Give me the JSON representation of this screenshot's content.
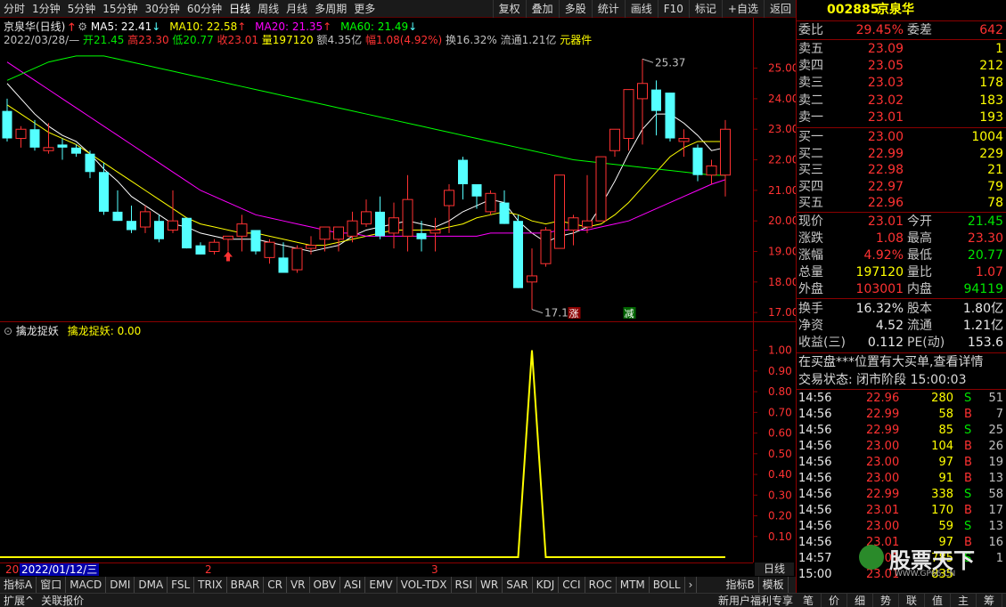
{
  "topbar": {
    "periods": [
      "分时",
      "1分钟",
      "5分钟",
      "15分钟",
      "30分钟",
      "60分钟",
      "日线",
      "周线",
      "月线",
      "多周期",
      "更多"
    ],
    "active_period": "日线",
    "buttons": [
      "复权",
      "叠加",
      "多股",
      "统计",
      "画线",
      "F10",
      "标记",
      "+自选",
      "返回"
    ]
  },
  "main": {
    "title": "京泉华(日线)",
    "ma5_label": "MA5: 22.41",
    "ma10_label": "MA10: 22.58",
    "ma20_label": "MA20: 21.35",
    "ma60_label": "MA60: 21.49",
    "info_date": "2022/03/28/—",
    "info_open": "开21.45",
    "info_high": "高23.30",
    "info_low": "低20.77",
    "info_close": "收23.01",
    "info_vol": "量197120",
    "info_amount": "额4.35亿",
    "info_change": "幅1.08(4.92%)",
    "info_turnover": "换16.32%",
    "info_float": "流通1.21亿",
    "info_sector": "元器件",
    "high_mark": "25.37",
    "low_mark": "17.11",
    "badge_up": "涨",
    "badge_down": "减",
    "colors": {
      "up": "#ff3232",
      "down": "#54ffff",
      "ma5": "#ffffff",
      "ma10": "#ffff00",
      "ma20": "#ff00ff",
      "ma60": "#00ff00"
    }
  },
  "sub": {
    "title": "擒龙捉妖",
    "value_label": "擒龙捉妖: 0.00"
  },
  "chart_data": [
    {
      "type": "candlestick",
      "title": "京泉华(日线)",
      "ylim": [
        16.8,
        25.6
      ],
      "yticks": [
        "25.00",
        "24.00",
        "23.00",
        "22.00",
        "21.00",
        "20.00",
        "19.00",
        "18.00",
        "17.00"
      ],
      "candles": [
        [
          23.6,
          24.0,
          22.6,
          22.7
        ],
        [
          22.7,
          23.1,
          22.4,
          23.0
        ],
        [
          23.0,
          23.3,
          22.3,
          22.4
        ],
        [
          22.3,
          23.2,
          22.2,
          22.4
        ],
        [
          22.5,
          22.7,
          22.0,
          22.4
        ],
        [
          22.4,
          22.5,
          22.1,
          22.2
        ],
        [
          22.2,
          22.3,
          21.4,
          21.6
        ],
        [
          21.6,
          21.9,
          20.2,
          20.3
        ],
        [
          20.3,
          21.0,
          20.0,
          20.0
        ],
        [
          20.0,
          20.5,
          19.6,
          19.7
        ],
        [
          19.8,
          20.5,
          19.6,
          20.3
        ],
        [
          20.0,
          20.2,
          19.3,
          19.4
        ],
        [
          19.7,
          21.0,
          19.6,
          20.0
        ],
        [
          20.1,
          20.1,
          19.1,
          19.1
        ],
        [
          19.2,
          19.3,
          18.9,
          18.9
        ],
        [
          19.0,
          19.4,
          18.9,
          19.3
        ],
        [
          19.4,
          19.5,
          19.0,
          19.5
        ],
        [
          19.5,
          20.2,
          19.0,
          19.9
        ],
        [
          19.7,
          19.7,
          18.9,
          19.0
        ],
        [
          18.8,
          19.4,
          18.6,
          19.3
        ],
        [
          18.8,
          19.3,
          18.3,
          18.3
        ],
        [
          18.4,
          19.2,
          18.3,
          19.1
        ],
        [
          19.1,
          19.5,
          18.9,
          19.2
        ],
        [
          19.4,
          19.8,
          19.0,
          19.8
        ],
        [
          19.4,
          19.8,
          19.0,
          19.8
        ],
        [
          19.5,
          20.3,
          19.3,
          20.0
        ],
        [
          19.9,
          20.7,
          19.8,
          20.3
        ],
        [
          20.3,
          20.8,
          19.4,
          19.5
        ],
        [
          19.6,
          20.6,
          19.1,
          20.1
        ],
        [
          19.5,
          21.5,
          19.0,
          20.7
        ],
        [
          19.6,
          20.0,
          19.0,
          19.4
        ],
        [
          19.6,
          20.1,
          19.0,
          19.7
        ],
        [
          20.5,
          21.2,
          19.6,
          21.0
        ],
        [
          22.0,
          22.1,
          20.7,
          21.2
        ],
        [
          21.2,
          21.2,
          20.4,
          20.8
        ],
        [
          20.3,
          21.0,
          20.2,
          20.9
        ],
        [
          20.6,
          21.0,
          19.9,
          19.9
        ],
        [
          20.0,
          20.2,
          17.8,
          17.8
        ],
        [
          18.0,
          19.1,
          17.1,
          18.2
        ],
        [
          18.6,
          19.8,
          18.5,
          19.7
        ],
        [
          19.1,
          21.5,
          19.1,
          21.5
        ],
        [
          19.7,
          20.2,
          19.2,
          20.1
        ],
        [
          19.8,
          21.5,
          19.6,
          20.0
        ],
        [
          20.0,
          22.1,
          20.0,
          22.1
        ],
        [
          22.3,
          23.0,
          22.1,
          23.0
        ],
        [
          22.7,
          24.0,
          22.3,
          24.3
        ],
        [
          24.0,
          25.3,
          22.5,
          24.5
        ],
        [
          24.3,
          24.6,
          22.8,
          23.6
        ],
        [
          24.2,
          24.2,
          22.6,
          22.7
        ],
        [
          22.6,
          23.0,
          22.1,
          22.7
        ],
        [
          22.4,
          22.5,
          21.3,
          21.5
        ],
        [
          21.5,
          22.0,
          21.2,
          21.8
        ],
        [
          21.5,
          23.3,
          20.8,
          23.0
        ]
      ],
      "series": [
        {
          "name": "MA5",
          "values": [
            24.5,
            24.0,
            23.5,
            23.1,
            22.8,
            22.6,
            22.2,
            21.7,
            21.3,
            20.8,
            20.5,
            20.2,
            19.9,
            19.8,
            19.6,
            19.5,
            19.4,
            19.4,
            19.4,
            19.3,
            19.2,
            19.1,
            19.0,
            19.1,
            19.2,
            19.5,
            19.7,
            19.8,
            19.9,
            20.0,
            19.9,
            19.8,
            20.0,
            20.3,
            20.5,
            20.7,
            20.6,
            20.0,
            19.6,
            19.3,
            19.5,
            19.6,
            19.8,
            20.5,
            21.3,
            22.2,
            23.0,
            23.5,
            23.5,
            23.2,
            22.8,
            22.3,
            22.4
          ]
        },
        {
          "name": "MA10",
          "values": [
            23.8,
            23.5,
            23.2,
            22.9,
            22.7,
            22.5,
            22.2,
            21.9,
            21.6,
            21.3,
            21.0,
            20.7,
            20.4,
            20.1,
            19.9,
            19.8,
            19.7,
            19.6,
            19.6,
            19.5,
            19.4,
            19.3,
            19.2,
            19.2,
            19.3,
            19.4,
            19.5,
            19.6,
            19.7,
            19.7,
            19.7,
            19.7,
            19.8,
            19.9,
            20.1,
            20.2,
            20.3,
            20.2,
            20.0,
            19.9,
            20.0,
            19.9,
            19.8,
            19.9,
            20.2,
            20.6,
            21.1,
            21.6,
            22.1,
            22.4,
            22.6,
            22.6,
            22.6
          ]
        },
        {
          "name": "MA20",
          "values": [
            25.2,
            24.9,
            24.6,
            24.3,
            24.0,
            23.7,
            23.4,
            23.1,
            22.8,
            22.5,
            22.2,
            21.9,
            21.6,
            21.3,
            21.0,
            20.8,
            20.6,
            20.4,
            20.2,
            20.1,
            20.0,
            19.9,
            19.8,
            19.7,
            19.6,
            19.6,
            19.5,
            19.5,
            19.5,
            19.5,
            19.5,
            19.5,
            19.5,
            19.5,
            19.5,
            19.6,
            19.6,
            19.6,
            19.6,
            19.6,
            19.7,
            19.7,
            19.7,
            19.8,
            19.9,
            20.0,
            20.2,
            20.4,
            20.6,
            20.8,
            21.0,
            21.2,
            21.35
          ]
        },
        {
          "name": "MA60",
          "values": [
            24.6,
            24.8,
            25.0,
            25.2,
            25.3,
            25.4,
            25.4,
            25.4,
            25.3,
            25.2,
            25.1,
            25.0,
            24.9,
            24.8,
            24.7,
            24.6,
            24.5,
            24.4,
            24.3,
            24.2,
            24.1,
            24.0,
            23.9,
            23.8,
            23.7,
            23.6,
            23.5,
            23.4,
            23.3,
            23.2,
            23.1,
            23.0,
            22.9,
            22.8,
            22.7,
            22.6,
            22.5,
            22.4,
            22.3,
            22.2,
            22.1,
            22.0,
            21.95,
            21.9,
            21.85,
            21.8,
            21.75,
            21.7,
            21.65,
            21.6,
            21.55,
            21.5,
            21.49
          ]
        }
      ]
    },
    {
      "type": "line",
      "title": "擒龙捉妖",
      "ylim": [
        0,
        1.05
      ],
      "yticks": [
        "1.00",
        "0.90",
        "0.80",
        "0.70",
        "0.60",
        "0.50",
        "0.40",
        "0.30",
        "0.20",
        "0.10"
      ],
      "series": [
        {
          "name": "擒龙捉妖",
          "values": [
            0,
            0,
            0,
            0,
            0,
            0,
            0,
            0,
            0,
            0,
            0,
            0,
            0,
            0,
            0,
            0,
            0,
            0,
            0,
            0,
            0,
            0,
            0,
            0,
            0,
            0,
            0,
            0,
            0,
            0,
            0,
            0,
            0,
            0,
            0,
            0,
            0,
            0,
            1,
            0,
            0,
            0,
            0,
            0,
            0,
            0,
            0,
            0,
            0,
            0,
            0,
            0,
            0
          ]
        }
      ]
    }
  ],
  "datebar": {
    "start_label": "20",
    "date_box": "2022/01/12/三",
    "month2": "2",
    "month3": "3"
  },
  "indicator_tabs": [
    "指标A",
    "窗口",
    "MACD",
    "DMI",
    "DMA",
    "FSL",
    "TRIX",
    "BRAR",
    "CR",
    "VR",
    "OBV",
    "ASI",
    "EMV",
    "VOL-TDX",
    "RSI",
    "WR",
    "SAR",
    "KDJ",
    "CCI",
    "ROC",
    "MTM",
    "BOLL",
    "›",
    "指标B",
    "模板",
    "《"
  ],
  "period_button": "日线",
  "statusbar": {
    "left1": "扩展^",
    "left2": "关联报价",
    "right": "新用户福利专享",
    "icons": [
      "笔",
      "价",
      "细",
      "势",
      "联",
      "值",
      "主",
      "筹"
    ]
  },
  "quote": {
    "code": "002885",
    "name": "京泉华",
    "weibi_label": "委比",
    "weibi": "29.45%",
    "weicha_label": "委差",
    "weicha": "642",
    "asks": [
      {
        "label": "卖五",
        "price": "23.09",
        "vol": "1"
      },
      {
        "label": "卖四",
        "price": "23.05",
        "vol": "212"
      },
      {
        "label": "卖三",
        "price": "23.03",
        "vol": "178"
      },
      {
        "label": "卖二",
        "price": "23.02",
        "vol": "183"
      },
      {
        "label": "卖一",
        "price": "23.01",
        "vol": "193"
      }
    ],
    "bids": [
      {
        "label": "买一",
        "price": "23.00",
        "vol": "1004"
      },
      {
        "label": "买二",
        "price": "22.99",
        "vol": "229"
      },
      {
        "label": "买三",
        "price": "22.98",
        "vol": "21"
      },
      {
        "label": "买四",
        "price": "22.97",
        "vol": "79"
      },
      {
        "label": "买五",
        "price": "22.96",
        "vol": "78"
      }
    ],
    "stats": [
      {
        "l1": "现价",
        "v1": "23.01",
        "c1": "red",
        "l2": "今开",
        "v2": "21.45",
        "c2": "green"
      },
      {
        "l1": "涨跌",
        "v1": "1.08",
        "c1": "red",
        "l2": "最高",
        "v2": "23.30",
        "c2": "red"
      },
      {
        "l1": "涨幅",
        "v1": "4.92%",
        "c1": "red",
        "l2": "最低",
        "v2": "20.77",
        "c2": "green"
      },
      {
        "l1": "总量",
        "v1": "197120",
        "c1": "yellow",
        "l2": "量比",
        "v2": "1.07",
        "c2": "red"
      },
      {
        "l1": "外盘",
        "v1": "103001",
        "c1": "red",
        "l2": "内盘",
        "v2": "94119",
        "c2": "green"
      }
    ],
    "stats2": [
      {
        "l1": "换手",
        "v1": "16.32%",
        "l2": "股本",
        "v2": "1.80亿"
      },
      {
        "l1": "净资",
        "v1": "4.52",
        "l2": "流通",
        "v2": "1.21亿"
      },
      {
        "l1": "收益(三)",
        "v1": "0.112",
        "l2": "PE(动)",
        "v2": "153.6"
      }
    ],
    "notice": "在买盘***位置有大买单,查看详情",
    "trade_status": "交易状态: 闭市阶段 15:00:03",
    "ticks": [
      {
        "t": "14:56",
        "p": "22.96",
        "v": "280",
        "s": "S",
        "n": "51"
      },
      {
        "t": "14:56",
        "p": "22.99",
        "v": "58",
        "s": "B",
        "n": "7"
      },
      {
        "t": "14:56",
        "p": "22.99",
        "v": "85",
        "s": "S",
        "n": "25"
      },
      {
        "t": "14:56",
        "p": "23.00",
        "v": "104",
        "s": "B",
        "n": "26"
      },
      {
        "t": "14:56",
        "p": "23.00",
        "v": "97",
        "s": "B",
        "n": "19"
      },
      {
        "t": "14:56",
        "p": "23.00",
        "v": "91",
        "s": "B",
        "n": "13"
      },
      {
        "t": "14:56",
        "p": "22.99",
        "v": "338",
        "s": "S",
        "n": "58"
      },
      {
        "t": "14:56",
        "p": "23.01",
        "v": "170",
        "s": "B",
        "n": "17"
      },
      {
        "t": "14:56",
        "p": "23.00",
        "v": "59",
        "s": "S",
        "n": "13"
      },
      {
        "t": "14:56",
        "p": "23.01",
        "v": "97",
        "s": "B",
        "n": "16"
      },
      {
        "t": "14:57",
        "p": "23.01",
        "v": "785",
        "s": "S",
        "n": "1"
      },
      {
        "t": "15:00",
        "p": "23.01",
        "v": "835",
        "s": "",
        "n": ""
      }
    ],
    "watermark": "股票天下",
    "watermark_url": "WWW.GP66.CN"
  }
}
